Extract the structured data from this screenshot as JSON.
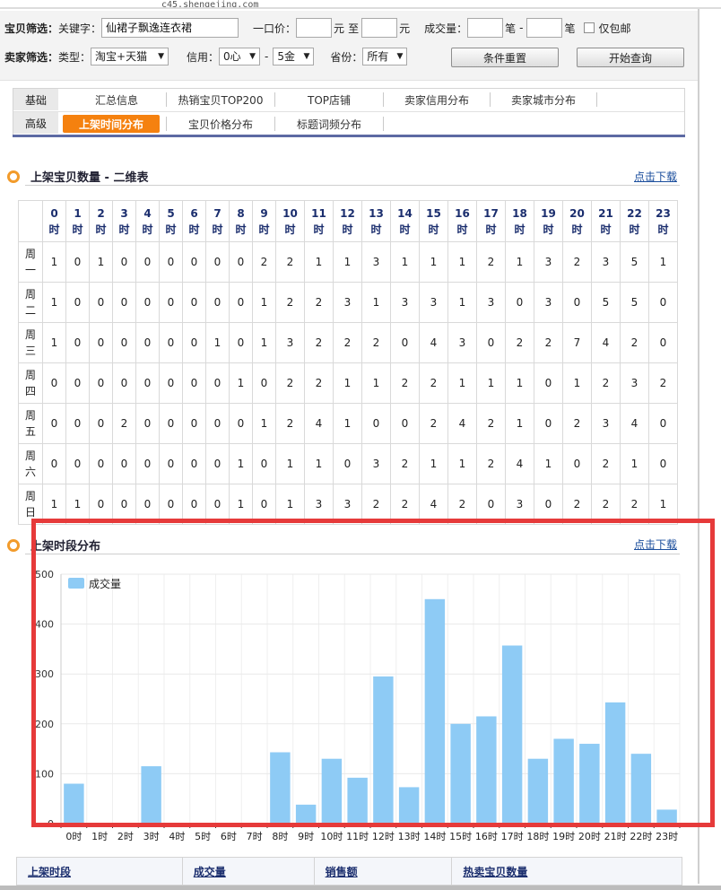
{
  "url": "c45.shengejing.com",
  "filters": {
    "row1_label": "宝贝筛选：",
    "keyword_label": "关键字：",
    "keyword_value": "仙裙子飘逸连衣裙",
    "price_label": "一口价：",
    "price_unit": "元",
    "price_to": "至",
    "sales_label": "成交量：",
    "sales_unit": "笔",
    "sales_dash": "-",
    "freeship_label": "仅包邮",
    "row2_label": "卖家筛选：",
    "type_label": "类型：",
    "type_value": "淘宝+天猫",
    "credit_label": "信用：",
    "credit_min": "0心",
    "credit_dash": "-",
    "credit_max": "5金",
    "province_label": "省份：",
    "province_value": "所有",
    "reset_label": "条件重置",
    "search_label": "开始查询"
  },
  "tabs": {
    "basic_head": "基础",
    "advanced_head": "高级",
    "basic": [
      "汇总信息",
      "热销宝贝TOP200",
      "TOP店铺",
      "卖家信用分布",
      "卖家城市分布"
    ],
    "advanced": [
      "上架时间分布",
      "宝贝价格分布",
      "标题词频分布"
    ],
    "active": "上架时间分布"
  },
  "section1": {
    "title": "上架宝贝数量 - 二维表",
    "download": "点击下载"
  },
  "section2": {
    "title": "上架时段分布",
    "download": "点击下载"
  },
  "grid": {
    "hours": [
      "0时",
      "1时",
      "2时",
      "3时",
      "4时",
      "5时",
      "6时",
      "7时",
      "8时",
      "9时",
      "10时",
      "11时",
      "12时",
      "13时",
      "14时",
      "15时",
      "16时",
      "17时",
      "18时",
      "19时",
      "20时",
      "21时",
      "22时",
      "23时"
    ],
    "rows": [
      {
        "day": "周一",
        "values": [
          1,
          0,
          1,
          0,
          0,
          0,
          0,
          0,
          0,
          2,
          2,
          1,
          1,
          3,
          1,
          1,
          1,
          2,
          1,
          3,
          2,
          3,
          5,
          1
        ]
      },
      {
        "day": "周二",
        "values": [
          1,
          0,
          0,
          0,
          0,
          0,
          0,
          0,
          0,
          1,
          2,
          2,
          3,
          1,
          3,
          3,
          1,
          3,
          0,
          3,
          0,
          5,
          5,
          0
        ]
      },
      {
        "day": "周三",
        "values": [
          1,
          0,
          0,
          0,
          0,
          0,
          0,
          1,
          0,
          1,
          3,
          2,
          2,
          2,
          0,
          4,
          3,
          0,
          2,
          2,
          7,
          4,
          2,
          0
        ]
      },
      {
        "day": "周四",
        "values": [
          0,
          0,
          0,
          0,
          0,
          0,
          0,
          0,
          1,
          0,
          2,
          2,
          1,
          1,
          2,
          2,
          1,
          1,
          1,
          0,
          1,
          2,
          3,
          2
        ]
      },
      {
        "day": "周五",
        "values": [
          0,
          0,
          0,
          2,
          0,
          0,
          0,
          0,
          0,
          1,
          2,
          4,
          1,
          0,
          0,
          2,
          4,
          2,
          1,
          0,
          2,
          3,
          4,
          0
        ]
      },
      {
        "day": "周六",
        "values": [
          0,
          0,
          0,
          0,
          0,
          0,
          0,
          0,
          1,
          0,
          1,
          1,
          0,
          3,
          2,
          1,
          1,
          2,
          4,
          1,
          0,
          2,
          1,
          0
        ]
      },
      {
        "day": "周日",
        "values": [
          1,
          1,
          0,
          0,
          0,
          0,
          0,
          0,
          1,
          0,
          1,
          3,
          3,
          2,
          2,
          4,
          2,
          0,
          3,
          0,
          2,
          2,
          2,
          1
        ]
      }
    ]
  },
  "chart_data": {
    "type": "bar",
    "categories": [
      "0时",
      "1时",
      "2时",
      "3时",
      "4时",
      "5时",
      "6时",
      "7时",
      "8时",
      "9时",
      "10时",
      "11时",
      "12时",
      "13时",
      "14时",
      "15时",
      "16时",
      "17时",
      "18时",
      "19时",
      "20时",
      "21时",
      "22时",
      "23时"
    ],
    "series": [
      {
        "name": "成交量",
        "values": [
          80,
          0,
          0,
          115,
          0,
          0,
          0,
          0,
          143,
          38,
          130,
          92,
          295,
          73,
          450,
          200,
          215,
          357,
          130,
          170,
          160,
          243,
          140,
          28
        ]
      }
    ],
    "yticks": [
      0,
      100,
      200,
      300,
      400,
      500
    ],
    "ylim": [
      0,
      500
    ],
    "legend_position": "top-left",
    "grid": true,
    "bar_color": "#8ecbf5"
  },
  "bottom_table": {
    "headers": [
      "上架时段",
      "成交量",
      "销售额",
      "热卖宝贝数量"
    ]
  }
}
